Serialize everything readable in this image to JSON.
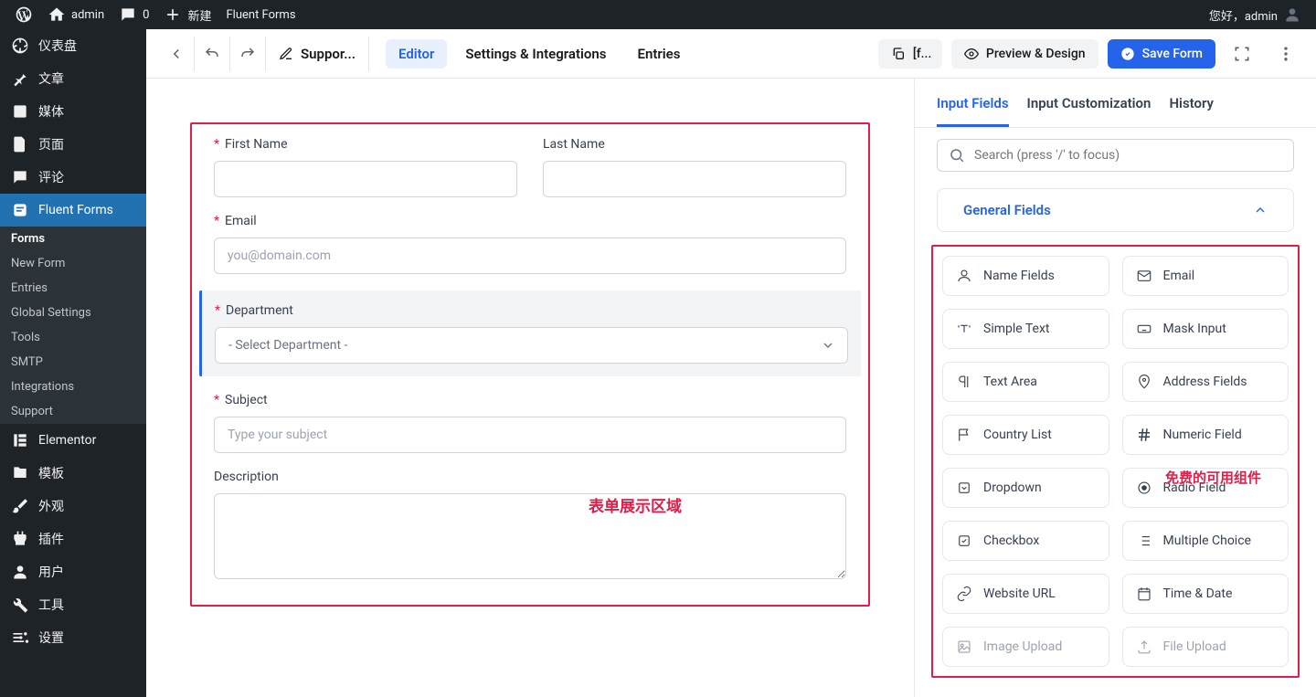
{
  "adminbar": {
    "site": "admin",
    "comments": "0",
    "new": "新建",
    "breadcrumb": "Fluent Forms",
    "greeting": "您好，admin"
  },
  "sidebar": {
    "dashboard": "仪表盘",
    "posts": "文章",
    "media": "媒体",
    "pages": "页面",
    "comments": "评论",
    "fluent": "Fluent Forms",
    "sub": {
      "forms": "Forms",
      "newform": "New Form",
      "entries": "Entries",
      "globalsettings": "Global Settings",
      "tools": "Tools",
      "smtp": "SMTP",
      "integrations": "Integrations",
      "support": "Support"
    },
    "elementor": "Elementor",
    "templates": "模板",
    "appearance": "外观",
    "plugins": "插件",
    "users": "用户",
    "tools": "工具",
    "settings": "设置"
  },
  "toolbar": {
    "title": "Suppor...",
    "tabs": {
      "editor": "Editor",
      "settings": "Settings & Integrations",
      "entries": "Entries"
    },
    "shortcode": "[f...",
    "preview": "Preview & Design",
    "save": "Save Form"
  },
  "form": {
    "firstname_label": "First Name",
    "lastname_label": "Last Name",
    "email_label": "Email",
    "email_placeholder": "you@domain.com",
    "department_label": "Department",
    "department_placeholder": "- Select Department -",
    "subject_label": "Subject",
    "subject_placeholder": "Type your subject",
    "description_label": "Description",
    "canvas_annotation": "表单展示区域"
  },
  "panel": {
    "tabs": {
      "input": "Input Fields",
      "custom": "Input Customization",
      "history": "History"
    },
    "search_placeholder": "Search (press '/' to focus)",
    "section": "General Fields",
    "fields": {
      "name": "Name Fields",
      "email": "Email",
      "simpletext": "Simple Text",
      "mask": "Mask Input",
      "textarea": "Text Area",
      "address": "Address Fields",
      "country": "Country List",
      "numeric": "Numeric Field",
      "dropdown": "Dropdown",
      "radio": "Radio Field",
      "checkbox": "Checkbox",
      "multiple": "Multiple Choice",
      "url": "Website URL",
      "datetime": "Time & Date",
      "image": "Image Upload",
      "file": "File Upload"
    },
    "fields_annotation": "免费的可用组件"
  }
}
